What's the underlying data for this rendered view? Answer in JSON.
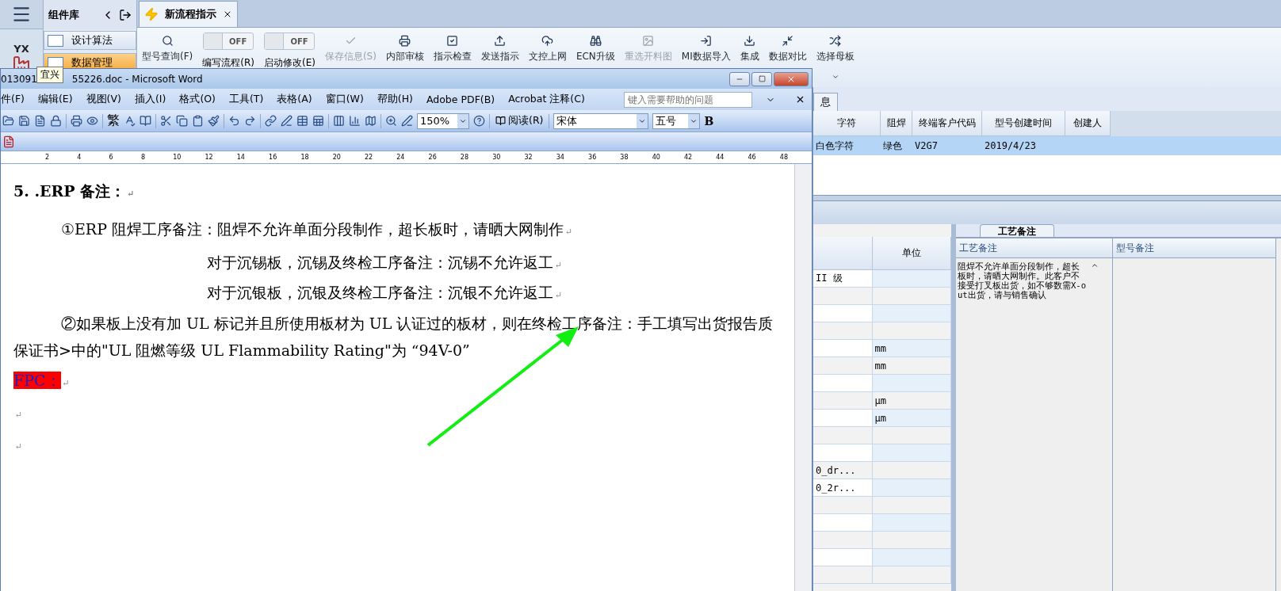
{
  "sidebar": {
    "logo": "YX",
    "tooltip": "宜兴"
  },
  "library": {
    "title": "组件库",
    "items": [
      {
        "label": "设计算法",
        "selected": false
      },
      {
        "label": "数据管理",
        "selected": true
      }
    ]
  },
  "doc_tab": {
    "label": "新流程指示"
  },
  "ribbon": [
    {
      "kind": "button",
      "label": "型号查询(F)",
      "disabled": false
    },
    {
      "kind": "toggle",
      "label": "编写流程(R)",
      "switch_text": "OFF",
      "on": false
    },
    {
      "kind": "toggle",
      "label": "启动修改(E)",
      "switch_text": "OFF",
      "on": false
    },
    {
      "kind": "button",
      "label": "保存信息(S)",
      "disabled": true
    },
    {
      "kind": "button",
      "label": "内部审核",
      "disabled": false
    },
    {
      "kind": "button",
      "label": "指示检查",
      "disabled": false
    },
    {
      "kind": "button",
      "label": "发送指示",
      "disabled": false
    },
    {
      "kind": "button",
      "label": "文控上网",
      "disabled": false
    },
    {
      "kind": "button",
      "label": "ECN升级",
      "disabled": false
    },
    {
      "kind": "button",
      "label": "重选开料图",
      "disabled": true
    },
    {
      "kind": "button",
      "label": "MI数据导入",
      "disabled": false
    },
    {
      "kind": "button",
      "label": "集成",
      "disabled": false
    },
    {
      "kind": "button",
      "label": "数据对比",
      "disabled": false
    },
    {
      "kind": "button",
      "label": "选择母板",
      "disabled": false,
      "dropdown": true
    }
  ],
  "info_panel": {
    "tab": "息",
    "columns": [
      "字符",
      "阻焊",
      "终端客户代码",
      "型号创建时间",
      "创建人"
    ],
    "rows": [
      {
        "selected": true,
        "cells": [
          "白色字符",
          "绿色",
          "V2G7",
          "2019/4/23",
          ""
        ]
      }
    ]
  },
  "param_grid": {
    "columns": [
      "",
      "单位"
    ],
    "rows": [
      [
        "II 级",
        ""
      ],
      [
        "",
        ""
      ],
      [
        "",
        ""
      ],
      [
        "",
        ""
      ],
      [
        "",
        "mm"
      ],
      [
        "",
        "mm"
      ],
      [
        "",
        ""
      ],
      [
        "",
        "μm"
      ],
      [
        "",
        "μm"
      ],
      [
        "",
        ""
      ],
      [
        "",
        ""
      ],
      [
        "0_dr...",
        ""
      ],
      [
        "0_2r...",
        ""
      ],
      [
        "",
        ""
      ],
      [
        "",
        ""
      ],
      [
        "",
        ""
      ],
      [
        "",
        ""
      ],
      [
        "",
        ""
      ]
    ]
  },
  "notes_panel": {
    "tab": "工艺备注",
    "columns": [
      "工艺备注",
      "型号备注"
    ],
    "process_note": "阻焊不允许单面分段制作，超长板时，请晒大网制作。此客户不接受打叉板出货，如不够数需X-out出货，请与销售确认"
  },
  "word_window": {
    "title_start": "013091",
    "title_end": "55226.doc - Microsoft Word",
    "menu": [
      "件(F)",
      "编辑(E)",
      "视图(V)",
      "插入(I)",
      "格式(O)",
      "工具(T)",
      "表格(A)",
      "窗口(W)",
      "帮助(H)",
      "Adobe PDF(B)",
      "Acrobat 注释(C)"
    ],
    "help_placeholder": "键入需要帮助的问题",
    "toolbar": {
      "traditional": "繁",
      "zoom": "150%",
      "reading": "阅读(R)",
      "font": "宋体",
      "size": "五号",
      "bold": "B"
    },
    "ruler": [
      "2",
      "4",
      "6",
      "8",
      "10",
      "12",
      "14",
      "16",
      "18",
      "20",
      "22",
      "24",
      "26",
      "28",
      "30",
      "32",
      "34",
      "36",
      "38",
      "40",
      "42",
      "44",
      "46",
      "48"
    ],
    "paragraphs": [
      {
        "kind": "heading",
        "text": "5. .ERP 备注：",
        "mark": "↵"
      },
      {
        "kind": "item",
        "text": "①ERP 阻焊工序备注：阻焊不允许单面分段制作，超长板时，请晒大网制作",
        "mark": "↵"
      },
      {
        "kind": "sub_item",
        "text": "对于沉锡板，沉锡及终检工序备注：沉锡不允许返工",
        "mark": "↵"
      },
      {
        "kind": "sub_item",
        "text": "对于沉银板，沉银及终检工序备注：沉银不允许返工",
        "mark": "↵"
      },
      {
        "kind": "item_wrap",
        "text": "②如果板上没有加 UL 标记并且所使用板材为 UL 认证过的板材，则在终检工序备注：手工填写出货报告质保证书>中的\"UL 阻燃等级 UL Flammability Rating\"为 “94V-0”"
      },
      {
        "kind": "highlight",
        "text": "FPC：",
        "mark": "↵"
      },
      {
        "kind": "empty",
        "mark": "↵"
      },
      {
        "kind": "empty",
        "mark": "↵"
      }
    ]
  }
}
